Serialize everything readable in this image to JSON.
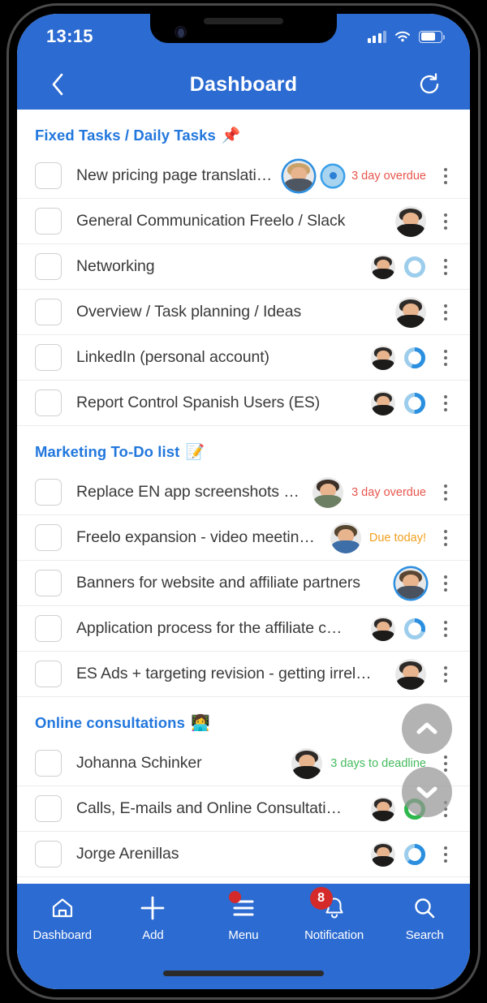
{
  "statusbar": {
    "time": "13:15",
    "signal_icon": "cellular-signal-icon",
    "wifi_icon": "wifi-icon",
    "battery_icon": "battery-icon"
  },
  "appbar": {
    "title": "Dashboard",
    "back_icon": "back-chevron-icon",
    "refresh_icon": "refresh-icon"
  },
  "colors": {
    "brand": "#2c6bd1",
    "section_heading": "#2277dd",
    "overdue": "#e8564d",
    "due_today": "#f0a020",
    "deadline": "#45bb5e",
    "badge": "#d42a2a"
  },
  "sections": [
    {
      "title": "Fixed Tasks / Daily Tasks",
      "emoji": "📌",
      "rows": [
        {
          "label": "New pricing page translati…",
          "avatar": "male-blond",
          "avatar_ring": true,
          "avatar_size": "big",
          "indicator": "target",
          "badge": "3 day overdue",
          "badge_type": "overdue"
        },
        {
          "label": "General Communication Freelo / Slack",
          "avatar": "female-dark",
          "avatar_size": "big",
          "indicator": "none",
          "badge": "",
          "badge_type": "none"
        },
        {
          "label": "Networking",
          "avatar": "female-dark",
          "indicator": "ring",
          "progress": 0,
          "badge": "",
          "badge_type": "none"
        },
        {
          "label": "Overview / Task planning / Ideas",
          "avatar": "female-dark",
          "avatar_size": "big",
          "indicator": "none",
          "badge": "",
          "badge_type": "none"
        },
        {
          "label": "LinkedIn (personal account)",
          "avatar": "female-dark",
          "indicator": "ring",
          "progress": 55,
          "badge": "",
          "badge_type": "none"
        },
        {
          "label": "Report Control Spanish Users (ES)",
          "avatar": "female-dark",
          "indicator": "ring",
          "progress": 50,
          "badge": "",
          "badge_type": "none"
        }
      ]
    },
    {
      "title": "Marketing To-Do list",
      "emoji": "📝",
      "rows": [
        {
          "label": "Replace EN app screenshots …",
          "avatar": "female-glasses",
          "avatar_size": "big",
          "indicator": "none",
          "badge": "3 day overdue",
          "badge_type": "overdue"
        },
        {
          "label": "Freelo expansion - video meetin…",
          "avatar": "male-green",
          "avatar_size": "big",
          "indicator": "none",
          "badge": "Due today!",
          "badge_type": "due"
        },
        {
          "label": "Banners for website and affiliate partners",
          "avatar": "male-beard",
          "avatar_ring": true,
          "avatar_size": "big",
          "indicator": "none",
          "badge": "",
          "badge_type": "none"
        },
        {
          "label": "Application process for the affiliate c…",
          "avatar": "female-dark",
          "indicator": "ring",
          "progress": 30,
          "badge": "",
          "badge_type": "none"
        },
        {
          "label": "ES Ads + targeting revision - getting irrel…",
          "avatar": "female-dark",
          "avatar_size": "big",
          "indicator": "none",
          "badge": "",
          "badge_type": "none"
        }
      ]
    },
    {
      "title": "Online consultations",
      "emoji": "👩‍💻",
      "rows": [
        {
          "label": "Johanna Schinker",
          "avatar": "female-dark",
          "avatar_size": "big",
          "indicator": "none",
          "badge": "3 days to deadline",
          "badge_type": "deadline"
        },
        {
          "label": "Calls, E-mails and Online Consultati…",
          "avatar": "female-dark",
          "indicator": "ring",
          "progress": 100,
          "ring_color": "#2eb84c",
          "badge": "",
          "badge_type": "none"
        },
        {
          "label": "Jorge Arenillas",
          "avatar": "female-dark",
          "indicator": "ring",
          "progress": 62,
          "badge": "",
          "badge_type": "none"
        }
      ]
    }
  ],
  "fabs": [
    {
      "name": "scroll-up-fab",
      "icon": "chevron-up-icon"
    },
    {
      "name": "scroll-down-fab",
      "icon": "chevron-down-icon"
    }
  ],
  "bottomnav": [
    {
      "label": "Dashboard",
      "icon": "home-icon",
      "badge": "",
      "badge_kind": "none",
      "active": true
    },
    {
      "label": "Add",
      "icon": "plus-icon",
      "badge": "",
      "badge_kind": "none",
      "active": false
    },
    {
      "label": "Menu",
      "icon": "hamburger-menu-icon",
      "badge": "",
      "badge_kind": "dot",
      "active": false
    },
    {
      "label": "Notification",
      "icon": "bell-icon",
      "badge": "8",
      "badge_kind": "number",
      "active": false
    },
    {
      "label": "Search",
      "icon": "search-icon",
      "badge": "",
      "badge_kind": "none",
      "active": false
    }
  ]
}
